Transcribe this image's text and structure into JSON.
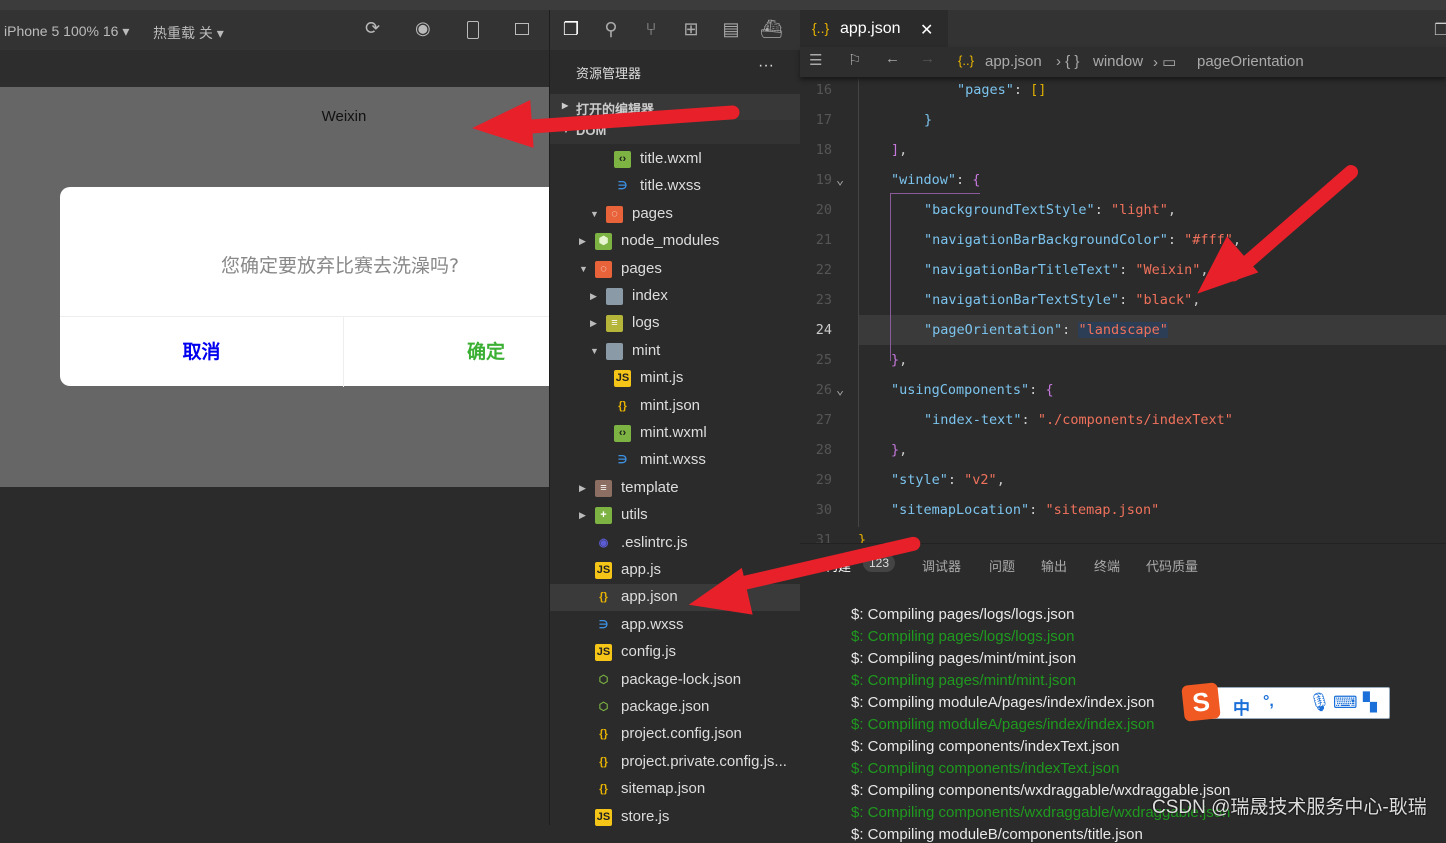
{
  "simulator": {
    "device": "iPhone 5 100% 16 ▾",
    "hot_reload": "热重载 关 ▾",
    "nav_title": "Weixin",
    "dialog": {
      "message": "您确定要放弃比赛去洗澡吗?",
      "cancel": "取消",
      "confirm": "确定",
      "cancel_color": "#0000ee",
      "confirm_color": "#3cb034"
    }
  },
  "explorer": {
    "title": "资源管理器",
    "more": "···",
    "open_editors": "打开的编辑器",
    "dom": "DOM",
    "items": [
      {
        "label": "title.wxml",
        "icon": "wxml",
        "level": 3
      },
      {
        "label": "title.wxss",
        "icon": "wxss",
        "level": 3
      },
      {
        "label": "pages",
        "icon": "folder-pages",
        "level": 2,
        "chev": "open"
      },
      {
        "label": "node_modules",
        "icon": "folder-node",
        "level": 1,
        "chev": "closed"
      },
      {
        "label": "pages",
        "icon": "folder-pages",
        "level": 1,
        "chev": "open"
      },
      {
        "label": "index",
        "icon": "folder",
        "level": 2,
        "chev": "closed"
      },
      {
        "label": "logs",
        "icon": "folder-logs",
        "level": 2,
        "chev": "closed"
      },
      {
        "label": "mint",
        "icon": "folder-open",
        "level": 2,
        "chev": "open"
      },
      {
        "label": "mint.js",
        "icon": "js",
        "level": 3
      },
      {
        "label": "mint.json",
        "icon": "json",
        "level": 3
      },
      {
        "label": "mint.wxml",
        "icon": "wxml",
        "level": 3
      },
      {
        "label": "mint.wxss",
        "icon": "wxss",
        "level": 3
      },
      {
        "label": "template",
        "icon": "folder-template",
        "level": 1,
        "chev": "closed"
      },
      {
        "label": "utils",
        "icon": "folder-utils",
        "level": 1,
        "chev": "closed"
      },
      {
        "label": ".eslintrc.js",
        "icon": "eslint",
        "level": 1
      },
      {
        "label": "app.js",
        "icon": "js",
        "level": 1
      },
      {
        "label": "app.json",
        "icon": "json",
        "level": 1,
        "selected": true
      },
      {
        "label": "app.wxss",
        "icon": "wxss",
        "level": 1
      },
      {
        "label": "config.js",
        "icon": "js",
        "level": 1
      },
      {
        "label": "package-lock.json",
        "icon": "node",
        "level": 1
      },
      {
        "label": "package.json",
        "icon": "node",
        "level": 1
      },
      {
        "label": "project.config.json",
        "icon": "json",
        "level": 1
      },
      {
        "label": "project.private.config.js...",
        "icon": "json",
        "level": 1
      },
      {
        "label": "sitemap.json",
        "icon": "json",
        "level": 1
      },
      {
        "label": "store.js",
        "icon": "js",
        "level": 1
      }
    ]
  },
  "editor": {
    "tab": "app.json",
    "tab_close": "✕",
    "breadcrumb": [
      "app.json",
      "window",
      "pageOrientation"
    ],
    "lines": [
      {
        "n": "16",
        "ind": 3,
        "tokens": [
          [
            "\"pages\"",
            "key"
          ],
          [
            ": ",
            "punc"
          ],
          [
            "[]",
            "brk"
          ]
        ]
      },
      {
        "n": "17",
        "ind": 2,
        "tokens": [
          [
            "}",
            "key"
          ]
        ]
      },
      {
        "n": "18",
        "ind": 1,
        "tokens": [
          [
            "]",
            "brc"
          ],
          [
            ",",
            "punc"
          ]
        ]
      },
      {
        "n": "19",
        "ind": 1,
        "fold": true,
        "tokens": [
          [
            "\"window\"",
            "key"
          ],
          [
            ": ",
            "punc"
          ],
          [
            "{",
            "brc"
          ]
        ]
      },
      {
        "n": "20",
        "ind": 2,
        "tokens": [
          [
            "\"backgroundTextStyle\"",
            "key"
          ],
          [
            ": ",
            "punc"
          ],
          [
            "\"light\"",
            "str"
          ],
          [
            ",",
            "punc"
          ]
        ]
      },
      {
        "n": "21",
        "ind": 2,
        "tokens": [
          [
            "\"navigationBarBackgroundColor\"",
            "key"
          ],
          [
            ": ",
            "punc"
          ],
          [
            "\"#fff\"",
            "str"
          ],
          [
            ",",
            "punc"
          ]
        ]
      },
      {
        "n": "22",
        "ind": 2,
        "tokens": [
          [
            "\"navigationBarTitleText\"",
            "key"
          ],
          [
            ": ",
            "punc"
          ],
          [
            "\"Weixin\"",
            "str"
          ],
          [
            ",",
            "punc"
          ]
        ]
      },
      {
        "n": "23",
        "ind": 2,
        "tokens": [
          [
            "\"navigationBarTextStyle\"",
            "key"
          ],
          [
            ": ",
            "punc"
          ],
          [
            "\"black\"",
            "str"
          ],
          [
            ",",
            "punc"
          ]
        ]
      },
      {
        "n": "24",
        "ind": 2,
        "current": true,
        "tokens": [
          [
            "\"pageOrientation\"",
            "key"
          ],
          [
            ": ",
            "punc"
          ],
          [
            "\"landscape\"",
            "str sel-str"
          ]
        ]
      },
      {
        "n": "25",
        "ind": 1,
        "tokens": [
          [
            "}",
            "brc"
          ],
          [
            ",",
            "punc"
          ]
        ]
      },
      {
        "n": "26",
        "ind": 1,
        "fold": true,
        "tokens": [
          [
            "\"usingComponents\"",
            "key"
          ],
          [
            ": ",
            "punc"
          ],
          [
            "{",
            "brc"
          ]
        ]
      },
      {
        "n": "27",
        "ind": 2,
        "tokens": [
          [
            "\"index-text\"",
            "key"
          ],
          [
            ": ",
            "punc"
          ],
          [
            "\"./components/indexText\"",
            "str"
          ]
        ]
      },
      {
        "n": "28",
        "ind": 1,
        "tokens": [
          [
            "}",
            "brc"
          ],
          [
            ",",
            "punc"
          ]
        ]
      },
      {
        "n": "29",
        "ind": 1,
        "tokens": [
          [
            "\"style\"",
            "key"
          ],
          [
            ": ",
            "punc"
          ],
          [
            "\"v2\"",
            "str"
          ],
          [
            ",",
            "punc"
          ]
        ]
      },
      {
        "n": "30",
        "ind": 1,
        "tokens": [
          [
            "\"sitemapLocation\"",
            "key"
          ],
          [
            ": ",
            "punc"
          ],
          [
            "\"sitemap.json\"",
            "str"
          ]
        ]
      },
      {
        "n": "31",
        "ind": 0,
        "tokens": [
          [
            "}",
            "brk"
          ]
        ]
      }
    ]
  },
  "panel": {
    "tabs": [
      "构建",
      "调试器",
      "问题",
      "输出",
      "终端",
      "代码质量"
    ],
    "build_count": "123",
    "console": [
      {
        "text": "$: Compiling pages/logs/logs.json",
        "green": false
      },
      {
        "text": "$: Compiling pages/logs/logs.json",
        "green": true
      },
      {
        "text": "$: Compiling pages/mint/mint.json",
        "green": false
      },
      {
        "text": "$: Compiling pages/mint/mint.json",
        "green": true
      },
      {
        "text": "$: Compiling moduleA/pages/index/index.json",
        "green": false
      },
      {
        "text": "$: Compiling moduleA/pages/index/index.json",
        "green": true
      },
      {
        "text": "$: Compiling components/indexText.json",
        "green": false
      },
      {
        "text": "$: Compiling components/indexText.json",
        "green": true
      },
      {
        "text": "$: Compiling components/wxdraggable/wxdraggable.json",
        "green": false
      },
      {
        "text": "$: Compiling components/wxdraggable/wxdraggable.json",
        "green": true
      },
      {
        "text": "$: Compiling moduleB/components/title.json",
        "green": false
      }
    ]
  },
  "ime": {
    "mode": "中",
    "punct": "°,"
  },
  "watermark": "CSDN @瑞晟技术服务中心-耿瑞"
}
